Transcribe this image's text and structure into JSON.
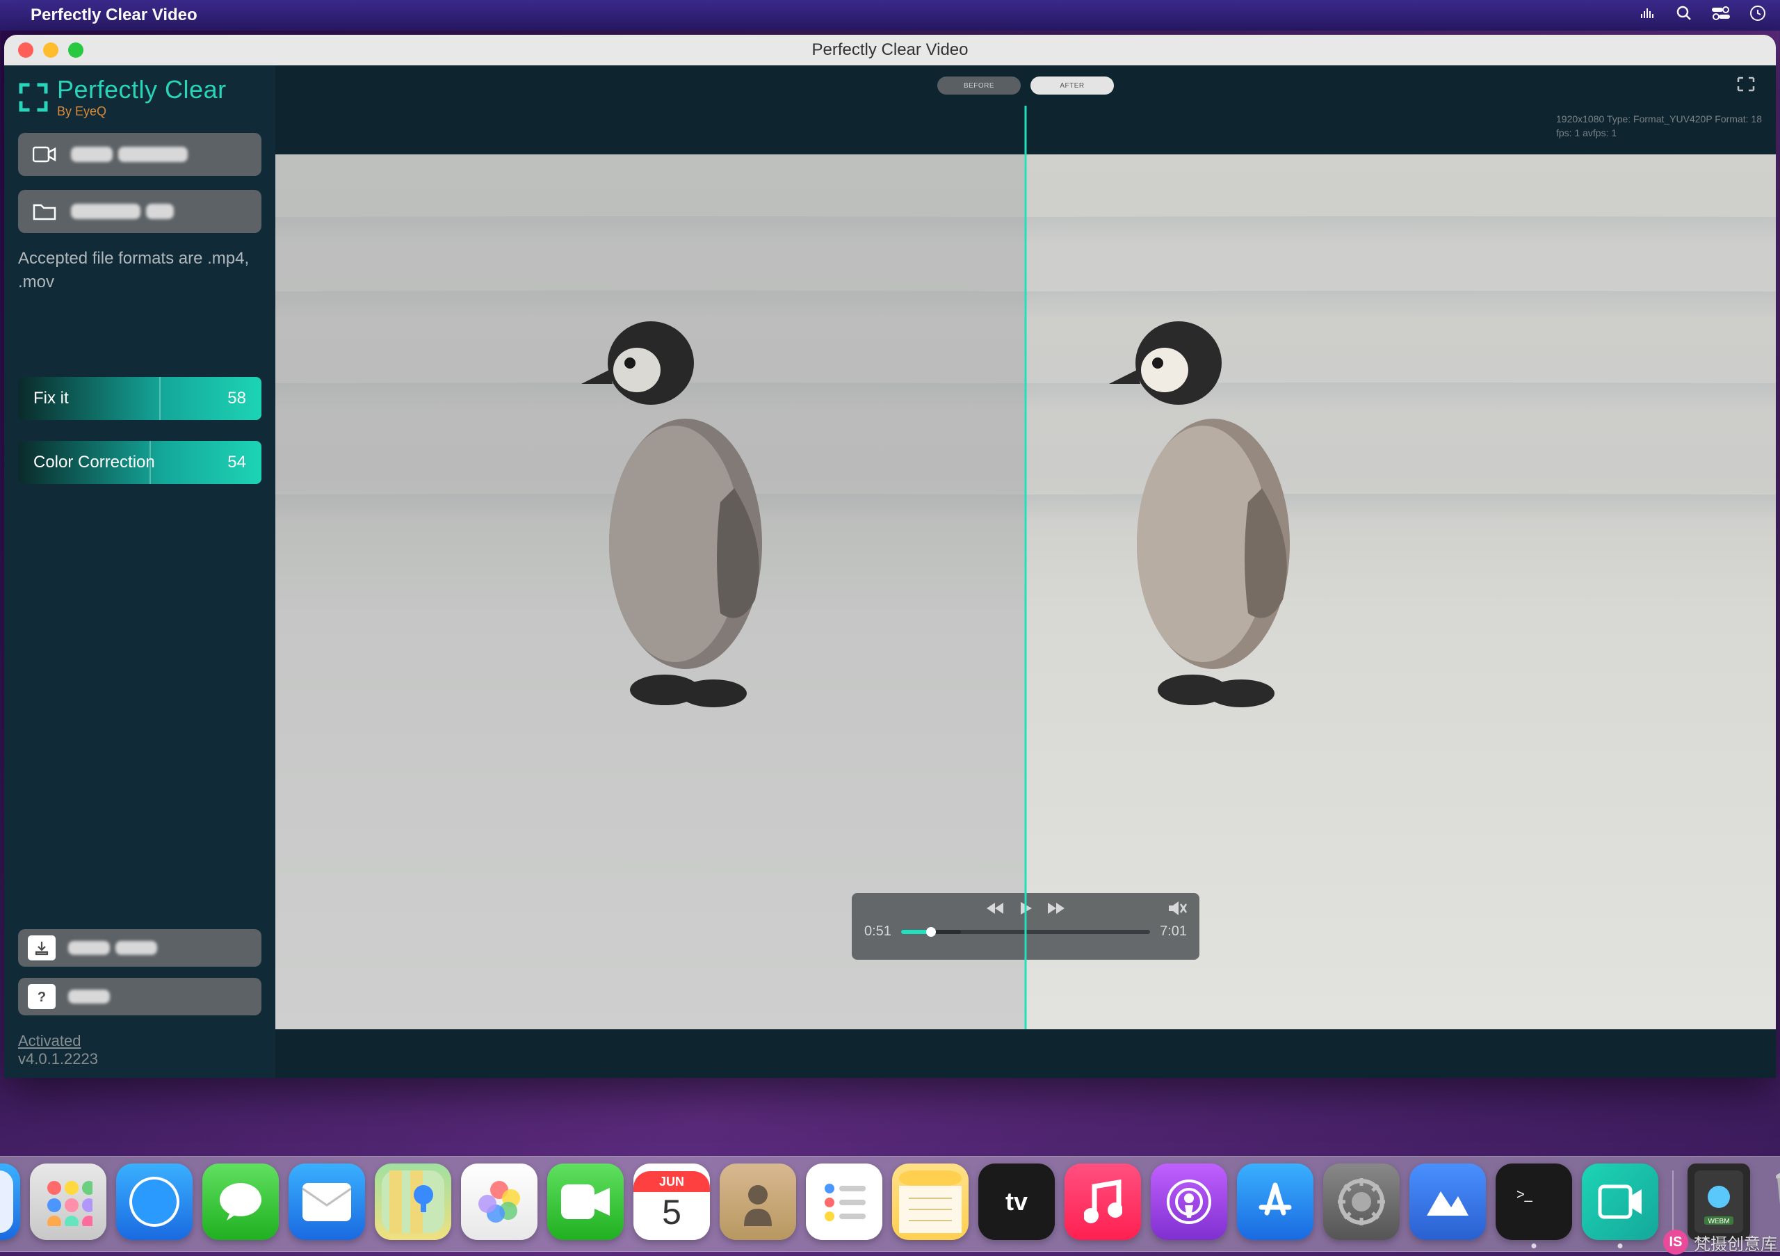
{
  "menubar": {
    "app_name": "Perfectly Clear Video"
  },
  "window": {
    "title": "Perfectly Clear Video"
  },
  "logo": {
    "main": "Perfectly Clear",
    "sub": "By EyeQ"
  },
  "sidebar": {
    "open_camera": "Open Camera",
    "choose_file": "Choose File",
    "hint": "Accepted file formats are .mp4, .mov",
    "sliders": [
      {
        "label": "Fix it",
        "value": 58,
        "pos": 58
      },
      {
        "label": "Color Correction",
        "value": 54,
        "pos": 54
      }
    ],
    "save_file": "Save File...",
    "help": "Help",
    "activated": "Activated",
    "version": "v4.0.1.2223"
  },
  "toolbar": {
    "before": "BEFORE",
    "after": "AFTER"
  },
  "player": {
    "current": "0:51",
    "duration": "7:01",
    "progress_pct": 12
  },
  "video_meta": {
    "line1": "1920x1080 Type: Format_YUV420P Format: 18",
    "line2": "fps: 1 avfps: 1"
  },
  "calendar": {
    "month": "JUN",
    "day": "5"
  },
  "watermark": {
    "text": "梵摄创意库"
  }
}
